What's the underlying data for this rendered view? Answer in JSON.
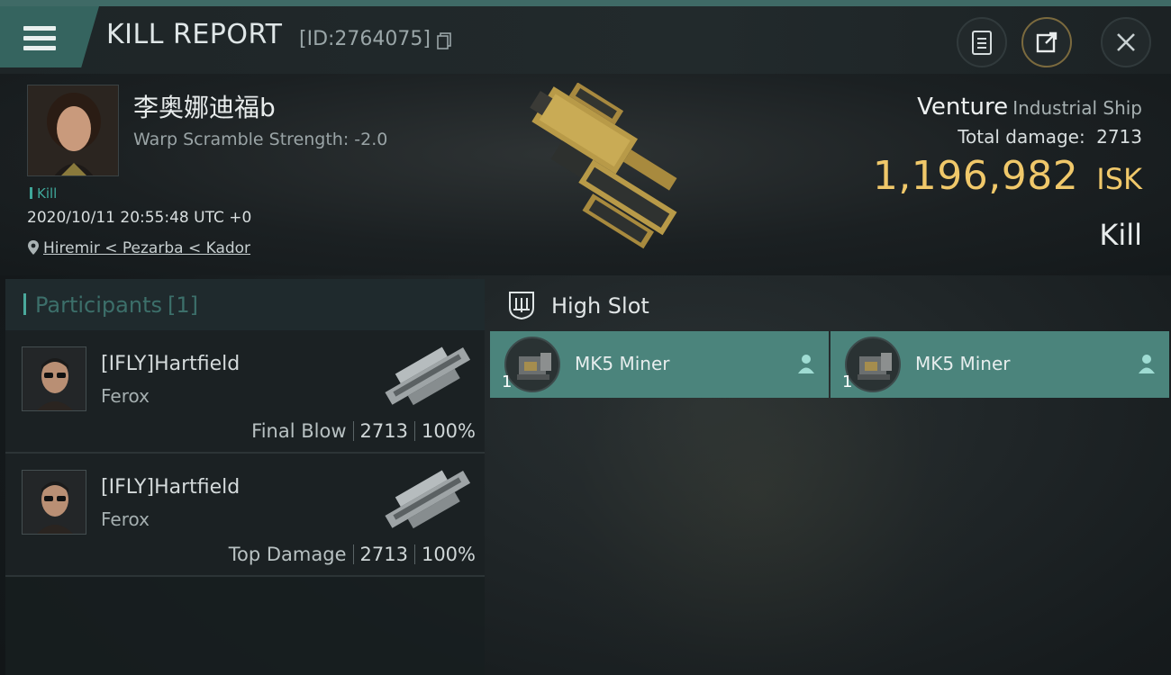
{
  "header": {
    "title": "KILL REPORT",
    "report_id": "[ID:2764075]",
    "icons": {
      "menu": "menu-icon",
      "copy": "copy-icon",
      "notes": "notes-icon",
      "share": "share-icon",
      "close": "close-icon"
    }
  },
  "victim": {
    "name": "李奥娜迪福b",
    "warp_scramble": "Warp Scramble Strength: -2.0",
    "tag": "Kill",
    "datetime": "2020/10/11 20:55:48 UTC +0",
    "location": "Hiremir < Pezarba < Kador",
    "ship_name": "Venture",
    "ship_class": "Industrial Ship",
    "total_damage_label": "Total damage:",
    "total_damage_value": "2713",
    "isk_value": "1,196,982",
    "isk_unit": "ISK",
    "result": "Kill"
  },
  "participants": {
    "title": "Participants",
    "count": "[1]",
    "rows": [
      {
        "name": "[IFLY]Hartfield",
        "ship": "Ferox",
        "label": "Final Blow",
        "damage": "2713",
        "percent": "100%"
      },
      {
        "name": "[IFLY]Hartfield",
        "ship": "Ferox",
        "label": "Top Damage",
        "damage": "2713",
        "percent": "100%"
      }
    ]
  },
  "slots": {
    "title": "High Slot",
    "modules": [
      {
        "name": "MK5 Miner",
        "qty": "1"
      },
      {
        "name": "MK5 Miner",
        "qty": "1"
      }
    ]
  },
  "colors": {
    "accent": "#4b847c",
    "isk": "#f0c86a",
    "header_tab": "#35645f"
  }
}
